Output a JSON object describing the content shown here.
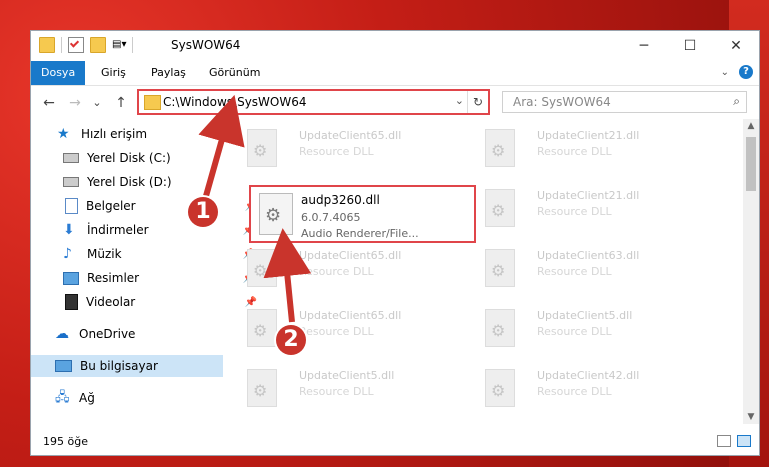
{
  "window": {
    "title": "SysWOW64",
    "controls": {
      "minimize": "─",
      "maximize": "☐",
      "close": "✕"
    }
  },
  "ribbon": {
    "tabs": [
      {
        "label": "Dosya"
      },
      {
        "label": "Giriş"
      },
      {
        "label": "Paylaş"
      },
      {
        "label": "Görünüm"
      }
    ],
    "help": "?"
  },
  "nav": {
    "back": "←",
    "forward": "→",
    "recent": "⌄",
    "up": "↑",
    "address": "C:\\Windows\\SysWOW64",
    "refresh": "↻",
    "search_placeholder": "Ara: SysWOW64",
    "search_icon": "⌕"
  },
  "sidebar": {
    "items": [
      {
        "label": "Hızlı erişim",
        "icon": "star-icon"
      },
      {
        "label": "Yerel Disk (C:)",
        "icon": "drive-icon"
      },
      {
        "label": "Yerel Disk (D:)",
        "icon": "drive-icon"
      },
      {
        "label": "Belgeler",
        "icon": "document-icon"
      },
      {
        "label": "İndirmeler",
        "icon": "download-icon"
      },
      {
        "label": "Müzik",
        "icon": "music-icon"
      },
      {
        "label": "Resimler",
        "icon": "pictures-icon"
      },
      {
        "label": "Videolar",
        "icon": "video-icon"
      },
      {
        "label": "OneDrive",
        "icon": "cloud-icon"
      },
      {
        "label": "Bu bilgisayar",
        "icon": "computer-icon"
      },
      {
        "label": "Ağ",
        "icon": "network-icon"
      }
    ]
  },
  "files": [
    {
      "name": "UpdateClient65.dll",
      "type": "Resource DLL"
    },
    {
      "name": "UpdateClient21.dll",
      "type": "Resource DLL"
    },
    {
      "name": "UpdateClient21.dll",
      "type": "Resource DLL"
    },
    {
      "name": "UpdateClient65.dll",
      "type": "Resource DLL"
    },
    {
      "name": "UpdateClient63.dll",
      "type": "Resource DLL"
    },
    {
      "name": "UpdateClient65.dll",
      "type": "Resource DLL"
    },
    {
      "name": "UpdateClient5.dll",
      "type": "Resource DLL"
    },
    {
      "name": "UpdateClient5.dll",
      "type": "Resource DLL"
    },
    {
      "name": "UpdateClient42.dll",
      "type": "Resource DLL"
    }
  ],
  "selected_file": {
    "name": "audp3260.dll",
    "version": "6.0.7.4065",
    "description": "Audio Renderer/File..."
  },
  "status": {
    "count": "195 öğe"
  },
  "annotations": [
    {
      "label": "1"
    },
    {
      "label": "2"
    }
  ],
  "colors": {
    "accent": "#1979ca",
    "highlight_border": "#e0454a",
    "annotation": "#c9342c"
  }
}
